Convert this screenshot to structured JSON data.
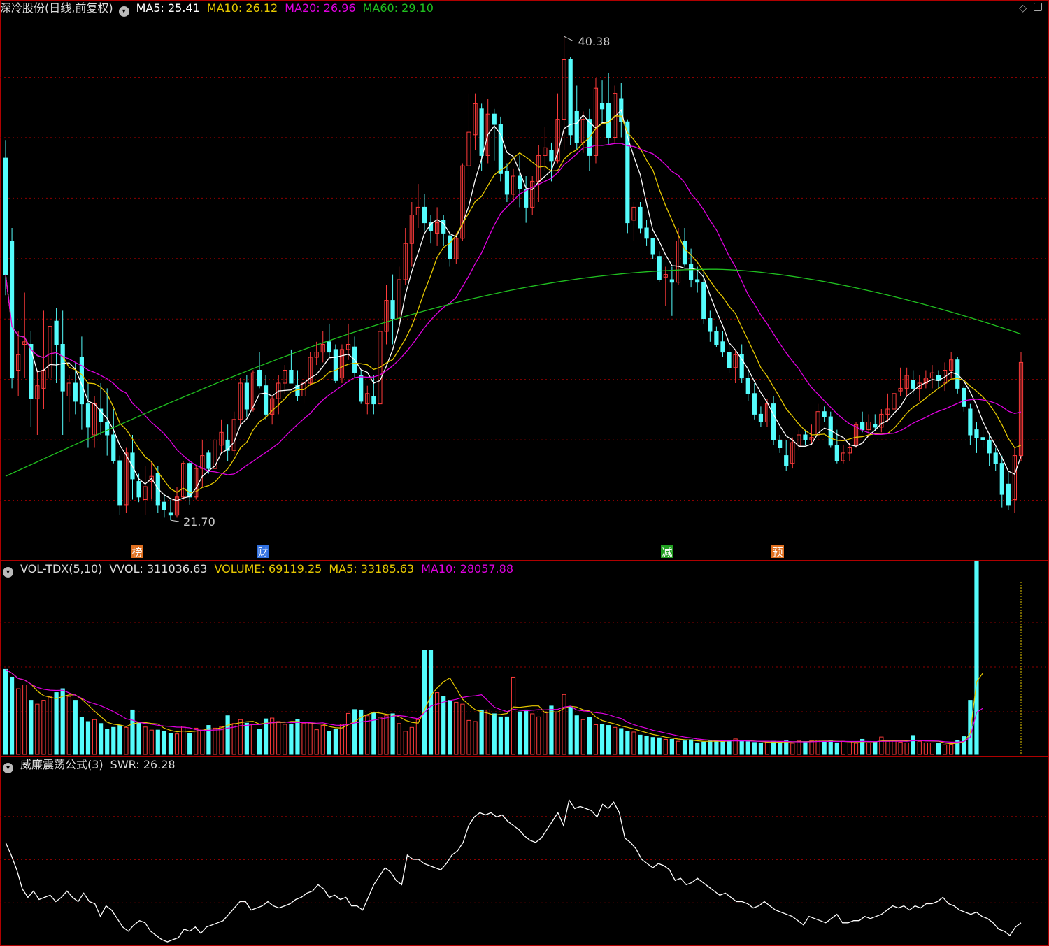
{
  "colors": {
    "up": "#ff3b3b",
    "down": "#54fcfc",
    "ma5": "#ffffff",
    "ma10": "#e6c800",
    "ma20": "#e000e0",
    "ma60": "#20c020",
    "grid": "#8b0000",
    "bg": "#000000"
  },
  "main": {
    "title": "深冷股份(日线,前复权)",
    "ma5_label": "MA5: 25.41",
    "ma10_label": "MA10: 26.12",
    "ma20_label": "MA20: 26.96",
    "ma60_label": "MA60: 29.10",
    "high_label": "40.38",
    "low_label": "21.70",
    "markers": [
      {
        "text": "榜",
        "color": "#e07020"
      },
      {
        "text": "财",
        "color": "#3070e0"
      },
      {
        "text": "减",
        "color": "#20a020"
      },
      {
        "text": "预",
        "color": "#e07020"
      }
    ]
  },
  "vol": {
    "title": "VOL-TDX(5,10)",
    "vvol": "VVOL: 311036.63",
    "volume": "VOLUME: 69119.25",
    "ma5": "MA5: 33185.63",
    "ma10": "MA10: 28057.88"
  },
  "swr": {
    "title": "威廉震荡公式(3)",
    "value": "SWR: 26.28"
  },
  "icons": {
    "top_right": [
      "diamond-icon",
      "square-icon"
    ]
  },
  "chart_data": [
    {
      "type": "candlestick",
      "name": "price",
      "ylim": [
        21,
        41
      ],
      "ohlc": [
        [
          35.7,
          36.4,
          30.4,
          31.2
        ],
        [
          32.5,
          33.0,
          26.8,
          27.2
        ],
        [
          27.5,
          29.0,
          26.5,
          28.1
        ],
        [
          28.5,
          30.5,
          27.2,
          28.6
        ],
        [
          28.5,
          29.0,
          25.3,
          26.4
        ],
        [
          26.4,
          27.5,
          25.0,
          26.9
        ],
        [
          26.8,
          29.8,
          26.0,
          27.5
        ],
        [
          27.2,
          29.5,
          26.7,
          29.2
        ],
        [
          29.4,
          29.9,
          27.0,
          28.5
        ],
        [
          28.5,
          29.8,
          25.0,
          26.7
        ],
        [
          26.5,
          27.3,
          25.5,
          27.0
        ],
        [
          27.0,
          27.8,
          25.8,
          26.3
        ],
        [
          28.0,
          28.8,
          25.2,
          26.2
        ],
        [
          26.2,
          27.0,
          24.5,
          25.3
        ],
        [
          25.0,
          26.5,
          24.5,
          26.2
        ],
        [
          26.0,
          27.0,
          25.0,
          25.5
        ],
        [
          25.5,
          26.8,
          24.2,
          25.0
        ],
        [
          25.0,
          26.0,
          23.9,
          24.0
        ],
        [
          24.0,
          24.2,
          21.9,
          22.3
        ],
        [
          22.3,
          24.5,
          22.0,
          24.3
        ],
        [
          24.3,
          25.0,
          22.5,
          23.3
        ],
        [
          23.2,
          23.5,
          22.4,
          22.6
        ],
        [
          22.5,
          23.8,
          21.9,
          23.0
        ],
        [
          23.2,
          24.0,
          22.5,
          23.4
        ],
        [
          23.5,
          23.8,
          22.0,
          22.3
        ],
        [
          22.4,
          22.7,
          21.8,
          22.1
        ],
        [
          22.0,
          22.5,
          21.7,
          21.9
        ],
        [
          21.9,
          23.0,
          21.8,
          22.6
        ],
        [
          22.6,
          24.0,
          22.5,
          23.9
        ],
        [
          23.9,
          24.0,
          22.3,
          22.6
        ],
        [
          22.6,
          23.8,
          22.5,
          23.7
        ],
        [
          23.7,
          24.8,
          23.0,
          24.2
        ],
        [
          24.3,
          24.4,
          23.5,
          23.7
        ],
        [
          23.7,
          25.0,
          23.5,
          24.8
        ],
        [
          24.6,
          25.6,
          24.3,
          25.1
        ],
        [
          24.8,
          25.4,
          24.0,
          24.4
        ],
        [
          24.4,
          25.9,
          24.2,
          25.6
        ],
        [
          25.6,
          27.2,
          25.4,
          27.0
        ],
        [
          27.0,
          27.3,
          25.7,
          26.0
        ],
        [
          26.0,
          27.5,
          25.9,
          27.4
        ],
        [
          27.5,
          28.2,
          26.8,
          26.9
        ],
        [
          26.9,
          27.3,
          25.6,
          25.8
        ],
        [
          25.8,
          26.5,
          25.4,
          26.4
        ],
        [
          26.4,
          27.3,
          25.8,
          27.0
        ],
        [
          27.0,
          27.7,
          26.6,
          27.5
        ],
        [
          27.5,
          28.3,
          27.0,
          27.0
        ],
        [
          26.9,
          27.5,
          26.3,
          26.5
        ],
        [
          26.5,
          27.3,
          26.2,
          27.0
        ],
        [
          27.0,
          28.2,
          26.9,
          28.0
        ],
        [
          28.0,
          28.6,
          27.7,
          28.2
        ],
        [
          28.2,
          29.0,
          27.8,
          28.5
        ],
        [
          28.6,
          29.3,
          28.0,
          28.2
        ],
        [
          28.3,
          28.5,
          27.0,
          27.1
        ],
        [
          27.2,
          28.5,
          27.0,
          28.3
        ],
        [
          28.3,
          29.3,
          27.9,
          28.5
        ],
        [
          28.4,
          28.8,
          27.2,
          27.4
        ],
        [
          27.3,
          27.5,
          26.2,
          26.3
        ],
        [
          26.2,
          26.9,
          25.8,
          26.6
        ],
        [
          26.5,
          27.3,
          25.8,
          26.2
        ],
        [
          26.2,
          29.2,
          26.1,
          29.0
        ],
        [
          29.0,
          30.8,
          28.5,
          30.2
        ],
        [
          30.2,
          31.2,
          28.5,
          29.5
        ],
        [
          29.5,
          31.5,
          29.0,
          31.0
        ],
        [
          31.0,
          33.0,
          30.8,
          32.4
        ],
        [
          32.4,
          34.0,
          31.5,
          33.5
        ],
        [
          33.5,
          34.7,
          33.0,
          33.8
        ],
        [
          33.8,
          34.3,
          32.9,
          33.2
        ],
        [
          33.2,
          33.5,
          32.4,
          32.9
        ],
        [
          32.8,
          33.8,
          32.3,
          33.2
        ],
        [
          33.3,
          33.5,
          32.3,
          32.8
        ],
        [
          32.7,
          32.8,
          31.5,
          31.8
        ],
        [
          31.8,
          32.8,
          31.6,
          32.6
        ],
        [
          32.6,
          35.5,
          32.5,
          35.4
        ],
        [
          35.4,
          38.2,
          34.8,
          36.7
        ],
        [
          36.6,
          38.2,
          36.0,
          37.8
        ],
        [
          37.6,
          37.8,
          35.2,
          35.8
        ],
        [
          35.8,
          38.0,
          35.5,
          37.4
        ],
        [
          37.4,
          37.6,
          35.6,
          37.0
        ],
        [
          37.0,
          37.3,
          34.8,
          35.1
        ],
        [
          35.2,
          35.5,
          34.0,
          34.3
        ],
        [
          34.3,
          35.3,
          34.0,
          35.0
        ],
        [
          35.0,
          35.8,
          33.8,
          34.5
        ],
        [
          34.5,
          35.0,
          33.2,
          33.8
        ],
        [
          33.8,
          35.0,
          33.5,
          34.8
        ],
        [
          34.8,
          36.2,
          34.0,
          35.8
        ],
        [
          35.8,
          36.9,
          35.2,
          36.1
        ],
        [
          36.0,
          36.3,
          34.8,
          35.6
        ],
        [
          35.6,
          38.2,
          35.5,
          37.2
        ],
        [
          37.2,
          40.4,
          36.0,
          39.5
        ],
        [
          39.5,
          39.6,
          36.2,
          36.6
        ],
        [
          37.5,
          38.5,
          36.0,
          36.3
        ],
        [
          36.3,
          37.5,
          35.9,
          37.2
        ],
        [
          37.2,
          37.6,
          35.2,
          35.8
        ],
        [
          35.8,
          38.8,
          35.5,
          38.4
        ],
        [
          37.8,
          38.7,
          37.0,
          37.6
        ],
        [
          37.8,
          39.0,
          36.2,
          36.5
        ],
        [
          36.5,
          38.5,
          36.3,
          38.2
        ],
        [
          38.0,
          38.6,
          36.5,
          37.1
        ],
        [
          37.1,
          37.2,
          32.8,
          33.2
        ],
        [
          33.3,
          34.0,
          32.5,
          33.8
        ],
        [
          33.8,
          34.0,
          32.8,
          33.0
        ],
        [
          33.0,
          33.3,
          32.3,
          32.6
        ],
        [
          32.6,
          32.6,
          31.8,
          32.0
        ],
        [
          31.9,
          32.1,
          30.9,
          31.0
        ],
        [
          31.1,
          31.5,
          30.0,
          31.2
        ],
        [
          31.0,
          31.5,
          29.6,
          30.9
        ],
        [
          30.9,
          33.0,
          30.8,
          32.5
        ],
        [
          32.5,
          33.0,
          31.5,
          31.6
        ],
        [
          31.6,
          32.2,
          30.7,
          31.0
        ],
        [
          31.0,
          31.5,
          30.5,
          30.9
        ],
        [
          30.9,
          31.3,
          29.3,
          29.5
        ],
        [
          29.5,
          29.8,
          28.6,
          29.0
        ],
        [
          29.0,
          29.2,
          28.4,
          28.5
        ],
        [
          28.6,
          29.0,
          28.0,
          28.2
        ],
        [
          28.2,
          28.5,
          27.4,
          27.6
        ],
        [
          27.6,
          28.3,
          27.0,
          28.1
        ],
        [
          28.1,
          28.5,
          27.0,
          27.2
        ],
        [
          27.2,
          27.5,
          26.3,
          26.6
        ],
        [
          26.6,
          27.0,
          25.6,
          25.8
        ],
        [
          25.8,
          26.1,
          25.3,
          25.5
        ],
        [
          25.5,
          26.4,
          25.3,
          26.2
        ],
        [
          26.2,
          26.5,
          24.6,
          24.8
        ],
        [
          24.8,
          25.0,
          24.3,
          24.5
        ],
        [
          24.2,
          24.8,
          23.6,
          23.8
        ],
        [
          23.9,
          24.9,
          23.7,
          24.7
        ],
        [
          24.6,
          25.2,
          24.4,
          25.0
        ],
        [
          25.0,
          25.2,
          24.6,
          24.8
        ],
        [
          24.8,
          25.4,
          24.6,
          24.9
        ],
        [
          25.0,
          26.2,
          24.8,
          25.9
        ],
        [
          25.9,
          26.1,
          25.5,
          25.7
        ],
        [
          25.7,
          25.9,
          24.5,
          24.6
        ],
        [
          24.6,
          25.2,
          23.9,
          24.0
        ],
        [
          24.0,
          24.6,
          23.9,
          24.3
        ],
        [
          24.3,
          24.7,
          24.0,
          24.5
        ],
        [
          24.6,
          25.5,
          24.5,
          25.4
        ],
        [
          25.5,
          25.9,
          25.1,
          25.2
        ],
        [
          25.2,
          25.8,
          24.9,
          25.5
        ],
        [
          25.4,
          25.8,
          25.2,
          25.3
        ],
        [
          25.3,
          26.0,
          25.1,
          25.8
        ],
        [
          25.8,
          26.6,
          25.5,
          26.0
        ],
        [
          26.0,
          26.9,
          25.8,
          26.6
        ],
        [
          26.7,
          27.6,
          26.5,
          26.8
        ],
        [
          26.8,
          27.6,
          26.5,
          27.3
        ],
        [
          27.1,
          27.5,
          26.6,
          26.8
        ],
        [
          26.8,
          27.3,
          26.3,
          27.0
        ],
        [
          27.0,
          27.5,
          26.8,
          27.2
        ],
        [
          27.2,
          27.7,
          26.8,
          27.4
        ],
        [
          27.3,
          27.5,
          26.8,
          27.1
        ],
        [
          27.0,
          27.8,
          26.7,
          27.5
        ],
        [
          27.5,
          28.2,
          27.2,
          27.9
        ],
        [
          27.9,
          28.0,
          26.6,
          26.8
        ],
        [
          26.8,
          26.9,
          25.9,
          26.1
        ],
        [
          26.0,
          26.2,
          24.6,
          25.0
        ],
        [
          25.2,
          25.5,
          24.3,
          24.9
        ],
        [
          24.9,
          25.3,
          24.5,
          24.8
        ],
        [
          24.8,
          25.0,
          23.8,
          24.3
        ],
        [
          24.3,
          24.5,
          23.6,
          23.9
        ],
        [
          23.9,
          24.2,
          22.2,
          22.7
        ],
        [
          23.1,
          23.6,
          22.1,
          22.3
        ],
        [
          22.5,
          24.5,
          22.0,
          24.2
        ],
        [
          24.2,
          28.2,
          24.0,
          27.8
        ]
      ],
      "ma60_start": 23.4,
      "ma60_peak": 31.4,
      "ma60_end": 28.9
    },
    {
      "type": "bar",
      "name": "volume",
      "ylim": [
        0,
        70000
      ],
      "values": [
        22000,
        20000,
        17000,
        18000,
        14000,
        13000,
        14000,
        15000,
        16000,
        17000,
        15000,
        14000,
        9500,
        8500,
        9000,
        8000,
        6600,
        7000,
        7500,
        7000,
        11500,
        8200,
        7100,
        6300,
        6300,
        6000,
        5400,
        5300,
        7300,
        5400,
        6800,
        6300,
        7500,
        6800,
        7200,
        10000,
        8000,
        9000,
        8100,
        7700,
        6500,
        9200,
        9400,
        8500,
        7800,
        7800,
        9000,
        8100,
        8100,
        6400,
        7500,
        6000,
        6500,
        7800,
        10600,
        11600,
        11500,
        10000,
        10800,
        9600,
        10000,
        10500,
        8000,
        6000,
        7000,
        9000,
        27000,
        27000,
        16000,
        15000,
        14000,
        13500,
        13000,
        8800,
        8500,
        11500,
        11500,
        10500,
        9700,
        9700,
        20000,
        11000,
        11500,
        10500,
        9700,
        11000,
        12500,
        11000,
        15500,
        12200,
        10000,
        9000,
        9500,
        7700,
        7800,
        7500,
        7000,
        6700,
        6000,
        5800,
        5000,
        4700,
        4400,
        4300,
        3900,
        3900,
        3400,
        3500,
        3800,
        3000,
        3200,
        3500,
        3700,
        3400,
        3600,
        4000,
        3400,
        3300,
        3100,
        3000,
        3200,
        3400,
        3200,
        3500,
        2900,
        3600,
        3300,
        3600,
        3700,
        3200,
        3500,
        3000,
        3400,
        3300,
        2900,
        3900,
        3000,
        3200,
        4500,
        3400,
        3500,
        3200,
        3000,
        4900,
        3400,
        3000,
        3000,
        2800,
        2500,
        2600,
        3700,
        4600,
        14000,
        69119
      ],
      "vvol_peak": 311036.63
    },
    {
      "type": "line",
      "name": "SWR",
      "ylim": [
        20,
        100
      ],
      "values": [
        68,
        62,
        55,
        46,
        42,
        45,
        41,
        42,
        43,
        40,
        42,
        45,
        42,
        40,
        44,
        40,
        39,
        33,
        38,
        36,
        32,
        28,
        26,
        29,
        31,
        30,
        26,
        24,
        22,
        21,
        22,
        23,
        27,
        26,
        28,
        25,
        28,
        29,
        30,
        31,
        34,
        37,
        40,
        40,
        36,
        37,
        38,
        40,
        38,
        37,
        38,
        39,
        41,
        42,
        44,
        45,
        48,
        46,
        42,
        43,
        41,
        42,
        38,
        38,
        36,
        42,
        48,
        52,
        56,
        54,
        50,
        48,
        62,
        60,
        60,
        58,
        57,
        56,
        55,
        58,
        62,
        64,
        68,
        76,
        80,
        82,
        81,
        82,
        80,
        81,
        78,
        76,
        74,
        71,
        69,
        68,
        70,
        74,
        78,
        82,
        76,
        88,
        84,
        85,
        84,
        83,
        80,
        86,
        84,
        87,
        82,
        70,
        68,
        65,
        60,
        58,
        56,
        58,
        57,
        55,
        50,
        51,
        48,
        49,
        51,
        49,
        47,
        45,
        43,
        44,
        42,
        40,
        40,
        39,
        37,
        38,
        40,
        38,
        36,
        35,
        34,
        33,
        31,
        29,
        33,
        32,
        31,
        30,
        32,
        34,
        30,
        30,
        31,
        31,
        33,
        32,
        33,
        34,
        36,
        38,
        37,
        38,
        36,
        38,
        37,
        39,
        39,
        40,
        42,
        39,
        38,
        36,
        35,
        34,
        35,
        33,
        32,
        30,
        27,
        26,
        24,
        28,
        30
      ]
    }
  ]
}
